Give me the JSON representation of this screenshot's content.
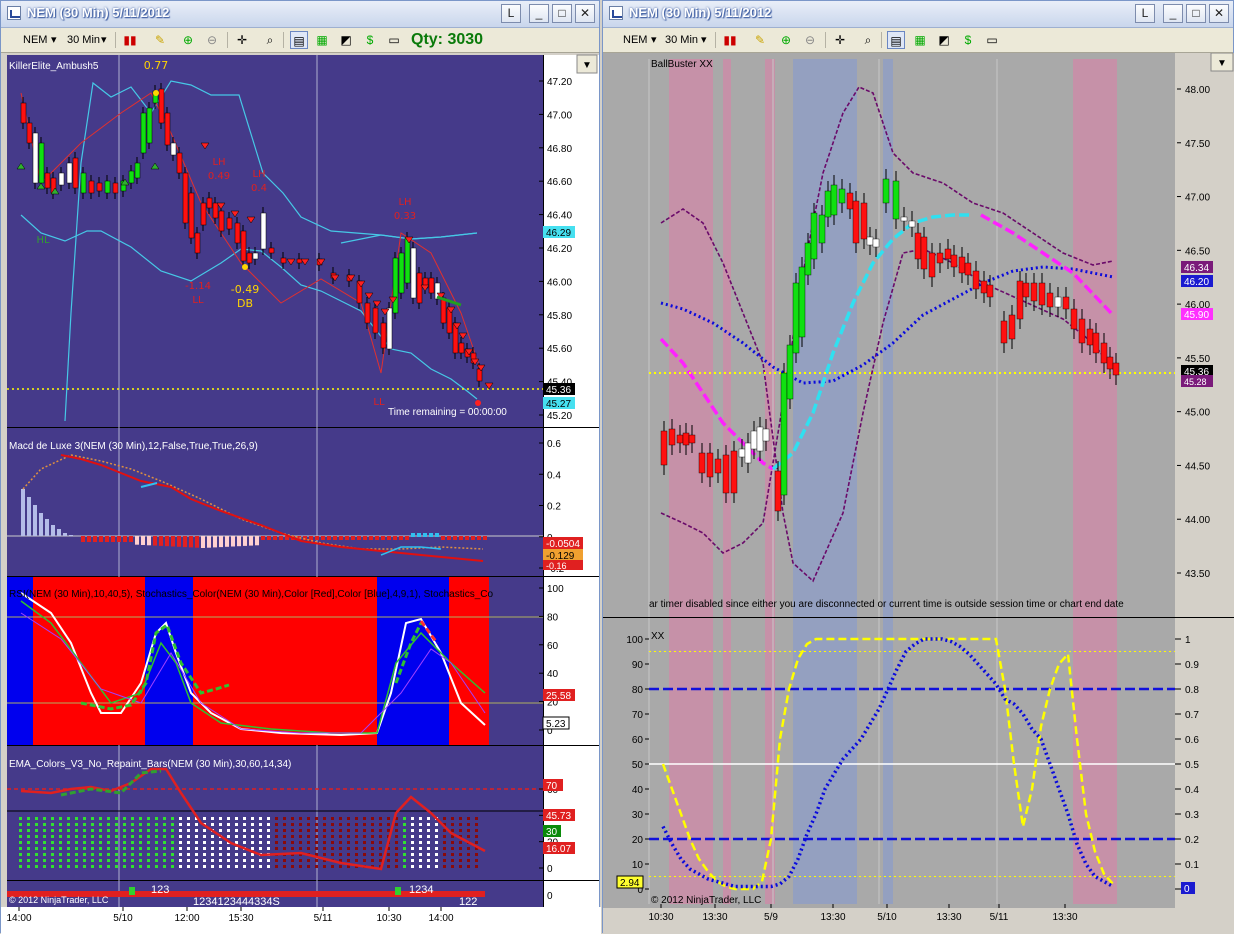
{
  "left_window": {
    "title": "NEM (30 Min)  5/11/2012",
    "toolbar": {
      "instrument": "NEM",
      "interval": "30 Min",
      "qty": "Qty: 3030"
    },
    "panels": {
      "price_label": "KillerElite_Ambush5",
      "macd_label": "Macd de Luxe 3(NEM (30 Min),12,False,True,True,26,9)",
      "stoch_label": "RSI(NEM (30 Min),10,40,5), Stochastics_Color(NEM (30 Min),Color [Red],Color [Blue],4,9,1), Stochastics_Co",
      "ema_label": "EMA_Colors_V3_No_Repaint_Bars(NEM (30 Min),30,60,14,34)",
      "copyright": "© 2012 NinjaTrader, LLC",
      "time_remaining": "Time remaining = 00:00:00"
    },
    "annotations": [
      "0.77",
      "LH",
      "0.49",
      "LH",
      "0.4",
      "LH",
      "0.33",
      "-0.49",
      "DB",
      "-1.14",
      "LL",
      "HL",
      "LL"
    ],
    "bottom_numbers": [
      "123",
      "1234",
      "1234123444334S",
      "122"
    ],
    "price_ticks": [
      "47.20",
      "47.00",
      "46.80",
      "46.60",
      "46.40",
      "46.20",
      "46.00",
      "45.80",
      "45.60",
      "45.40",
      "45.20"
    ],
    "price_markers": [
      "46.29",
      "45.36",
      "45.27"
    ],
    "macd_ticks": [
      "0.6",
      "0.4",
      "0.2",
      "0",
      "-0.2"
    ],
    "macd_markers": [
      "-0.0504",
      "-0.129",
      "-0.16"
    ],
    "stoch_ticks": [
      "100",
      "80",
      "60",
      "40",
      "20",
      "0"
    ],
    "stoch_markers": [
      "25.58",
      "5.23"
    ],
    "ema_ticks": [
      "60",
      "40",
      "20",
      "0"
    ],
    "ema_markers": [
      "70",
      "45.73",
      "30",
      "16.07"
    ],
    "bottom_tick": "0",
    "time_labels": [
      "14:00",
      "5/10",
      "12:00",
      "15:30",
      "5/11",
      "10:30",
      "14:00"
    ]
  },
  "right_window": {
    "title": "NEM (30 Min)  5/11/2012",
    "toolbar": {
      "instrument": "NEM",
      "interval": "30 Min"
    },
    "panels": {
      "price_label": "BallBuster XX",
      "timer_message": "ar timer disabled since either you are disconnected or current time is outside session time or chart end date",
      "osc_label": "XX",
      "copyright": "© 2012 NinjaTrader, LLC"
    },
    "price_ticks": [
      "48.00",
      "47.50",
      "47.00",
      "46.50",
      "46.00",
      "45.50",
      "45.00",
      "44.50",
      "44.00",
      "43.50"
    ],
    "price_markers": [
      "46.34",
      "46.20",
      "45.90",
      "45.36",
      "45.28"
    ],
    "osc_left_ticks": [
      "100",
      "90",
      "80",
      "70",
      "60",
      "50",
      "40",
      "30",
      "20",
      "10",
      "0"
    ],
    "osc_right_ticks": [
      "1",
      "0.9",
      "0.8",
      "0.7",
      "0.6",
      "0.5",
      "0.4",
      "0.3",
      "0.2",
      "0.1",
      "0"
    ],
    "osc_markers": {
      "left": "2.94",
      "right": "0"
    },
    "time_labels": [
      "10:30",
      "13:30",
      "5/9",
      "13:30",
      "5/10",
      "13:30",
      "5/11",
      "13:30"
    ]
  },
  "colors": {
    "left_bg": "#453a8a",
    "right_bg": "#a9a9a9",
    "bull": "#00dd00",
    "bear": "#dd0000",
    "yellow_line": "#ffff00"
  },
  "icons": [
    "chart-icon",
    "minimize-icon",
    "maximize-icon",
    "close-icon",
    "bar-style-icon",
    "pencil-icon",
    "zoom-icon",
    "crosshair-icon",
    "properties-icon"
  ]
}
